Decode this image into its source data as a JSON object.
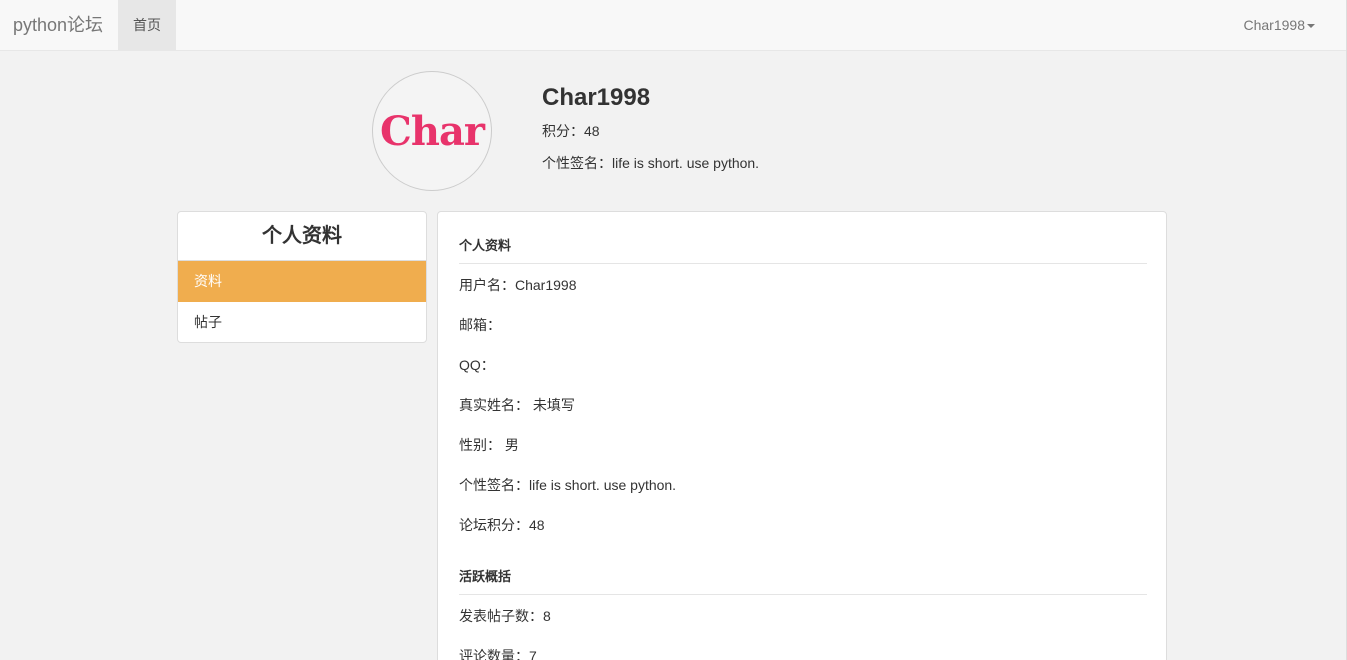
{
  "navbar": {
    "brand": "python论坛",
    "home": "首页",
    "user": "Char1998"
  },
  "profile": {
    "avatar_text": "Char",
    "name": "Char1998",
    "points_label": "积分：",
    "points": "48",
    "signature_label": "个性签名：",
    "signature": "life is short. use python."
  },
  "sidebar": {
    "title": "个人资料",
    "items": [
      {
        "label": "资料",
        "active": true
      },
      {
        "label": "帖子",
        "active": false
      }
    ]
  },
  "main": {
    "section1_title": "个人资料",
    "fields": [
      {
        "label": "用户名：",
        "value": "Char1998"
      },
      {
        "label": "邮箱：",
        "value": ""
      },
      {
        "label": "QQ：",
        "value": ""
      },
      {
        "label": "真实姓名：",
        "value": " 未填写"
      },
      {
        "label": "性别：",
        "value": " 男"
      },
      {
        "label": "个性签名：",
        "value": "life is short. use python."
      },
      {
        "label": "论坛积分：",
        "value": "48"
      }
    ],
    "section2_title": "活跃概括",
    "activity": [
      {
        "label": "发表帖子数：",
        "value": "8"
      },
      {
        "label": "评论数量：",
        "value": "7"
      }
    ]
  },
  "colors": {
    "active_item": "#f0ad4e",
    "avatar_text": "#e8336b"
  }
}
